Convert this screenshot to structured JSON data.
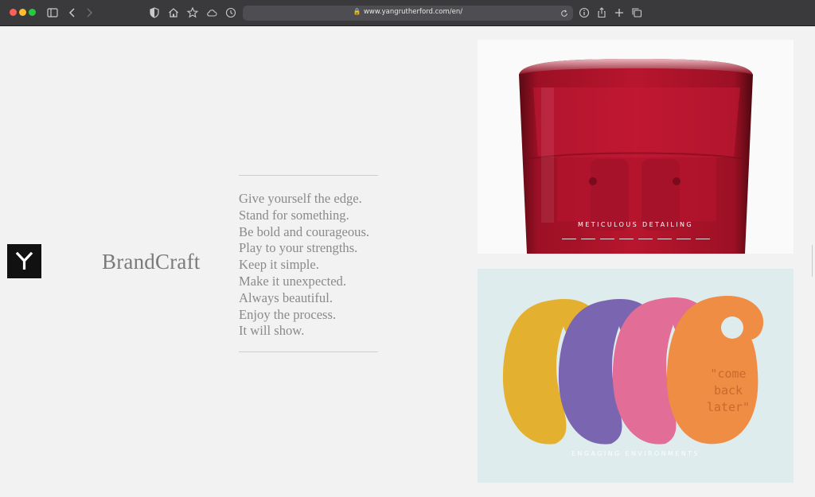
{
  "browser": {
    "url": "www.yangrutherford.com/en/"
  },
  "site": {
    "brand_name": "BrandCraft",
    "tagline_lines": [
      "Give yourself the edge.",
      "Stand for something.",
      "Be bold and courageous.",
      "Play to your strengths.",
      "Keep it simple.",
      "Make it unexpected.",
      "Always beautiful.",
      "Enjoy the process.",
      "It will show."
    ]
  },
  "tiles": {
    "red": {
      "caption": "METICULOUS DETAILING",
      "accent": "#b3122b"
    },
    "tags": {
      "caption": "ENGAGING ENVIRONMENTS",
      "tag_text": [
        "\"come",
        "back",
        "later\""
      ],
      "tag_colors": [
        "#e3b12f",
        "#7a65b0",
        "#e26d97",
        "#f08d45"
      ]
    }
  },
  "icons": {
    "sidebar": "sidebar-icon",
    "back": "chevron-left-icon",
    "forward": "chevron-right-icon",
    "shield": "privacy-shield-icon",
    "home": "home-icon",
    "star": "star-icon",
    "cloud": "cloud-icon",
    "history": "clock-icon",
    "reload": "reload-icon",
    "info": "info-icon",
    "share": "share-icon",
    "new_tab": "plus-icon",
    "tabs": "tabs-icon"
  }
}
